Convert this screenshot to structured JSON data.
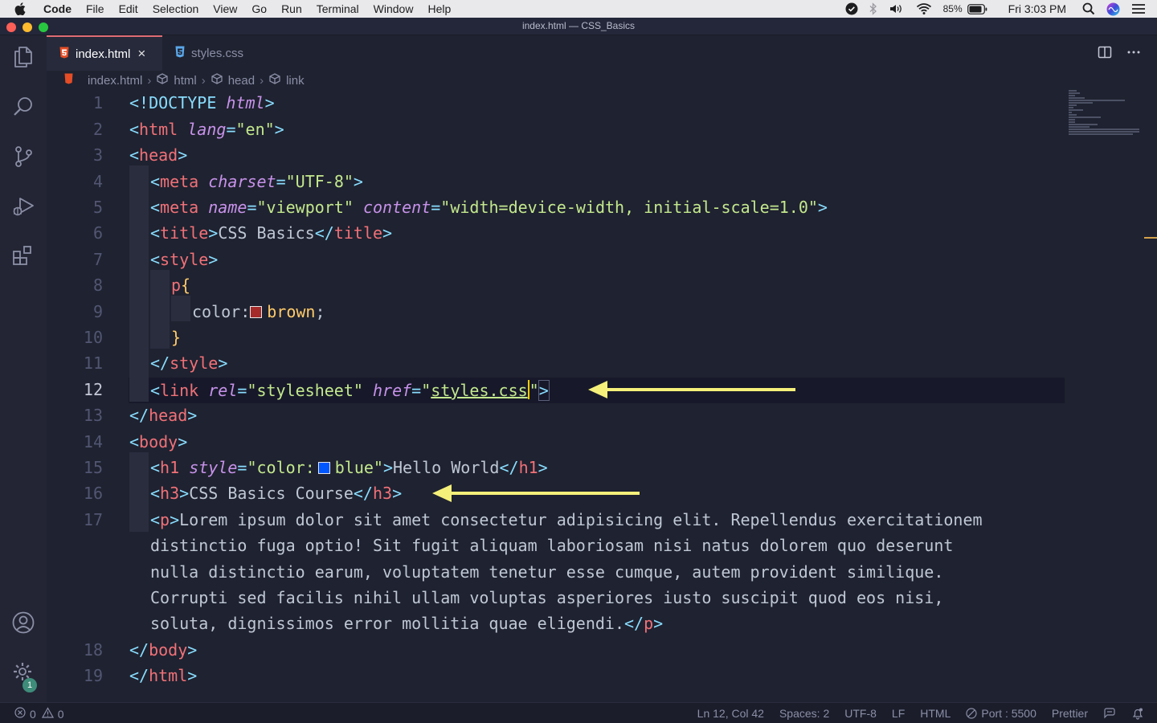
{
  "menubar": {
    "app": "Code",
    "items": [
      "File",
      "Edit",
      "Selection",
      "View",
      "Go",
      "Run",
      "Terminal",
      "Window",
      "Help"
    ],
    "battery": "85%",
    "clock": "Fri 3:03 PM"
  },
  "window": {
    "title": "index.html — CSS_Basics"
  },
  "tabs": [
    {
      "label": "index.html",
      "active": true
    },
    {
      "label": "styles.css",
      "active": false
    }
  ],
  "breadcrumb": [
    "index.html",
    "html",
    "head",
    "link"
  ],
  "editor": {
    "line_numbers": [
      "1",
      "2",
      "3",
      "4",
      "5",
      "6",
      "7",
      "8",
      "9",
      "10",
      "11",
      "12",
      "13",
      "14",
      "15",
      "16",
      "17",
      "18",
      "19"
    ],
    "tokens": {
      "l1_doctype": "<!DOCTYPE ",
      "l1_html": "html",
      "l1_close": ">",
      "l2_open": "<",
      "l2_tag": "html",
      "l2_attr": "lang",
      "l2_eq": "=",
      "l2_val": "\"en\"",
      "l2_close": ">",
      "l3_open": "<",
      "l3_tag": "head",
      "l3_close": ">",
      "l4_open": "<",
      "l4_tag": "meta",
      "l4_attr": "charset",
      "l4_eq": "=",
      "l4_val": "\"UTF-8\"",
      "l4_close": ">",
      "l5_open": "<",
      "l5_tag": "meta",
      "l5_attr1": "name",
      "l5_eq1": "=",
      "l5_val1": "\"viewport\"",
      "l5_attr2": "content",
      "l5_eq2": "=",
      "l5_val2": "\"width=device-width, initial-scale=1.0\"",
      "l5_close": ">",
      "l6_open": "<",
      "l6_tag": "title",
      "l6_mid": ">",
      "l6_text": "CSS Basics",
      "l6_endopen": "</",
      "l6_endtag": "title",
      "l6_close": ">",
      "l7_open": "<",
      "l7_tag": "style",
      "l7_close": ">",
      "l8_sel": "p",
      "l8_brace": "{",
      "l9_prop": "color:",
      "l9_val": "brown",
      "l9_semi": ";",
      "l10_brace": "}",
      "l11_open": "</",
      "l11_tag": "style",
      "l11_close": ">",
      "l12_open": "<",
      "l12_tag": "link",
      "l12_attr1": "rel",
      "l12_eq1": "=",
      "l12_val1": "\"stylesheet\"",
      "l12_attr2": "href",
      "l12_eq2": "=",
      "l12_q1": "\"",
      "l12_file": "styles.css",
      "l12_q2": "\"",
      "l12_close": ">",
      "l13_open": "</",
      "l13_tag": "head",
      "l13_close": ">",
      "l14_open": "<",
      "l14_tag": "body",
      "l14_close": ">",
      "l15_open": "<",
      "l15_tag": "h1",
      "l15_attr": "style",
      "l15_eq": "=",
      "l15_val1": "\"color:",
      "l15_val2": "blue\"",
      "l15_mid": ">",
      "l15_text": "Hello World",
      "l15_endopen": "</",
      "l15_endtag": "h1",
      "l15_close": ">",
      "l16_open": "<",
      "l16_tag": "h3",
      "l16_mid": ">",
      "l16_text": "CSS Basics Course",
      "l16_endopen": "</",
      "l16_endtag": "h3",
      "l16_close": ">",
      "l17_open": "<",
      "l17_tag": "p",
      "l17_mid": ">",
      "l17_text1": "Lorem ipsum dolor sit amet consectetur adipisicing elit. Repellendus exercitationem",
      "l17_text2": "distinctio fuga optio! Sit fugit aliquam laboriosam nisi natus dolorem quo deserunt",
      "l17_text3": "nulla distinctio earum, voluptatem tenetur esse cumque, autem provident similique.",
      "l17_text4": "Corrupti sed facilis nihil ullam voluptas asperiores iusto suscipit quod eos nisi,",
      "l17_text5": "soluta, dignissimos error mollitia quae eligendi.",
      "l17_endopen": "</",
      "l17_endtag": "p",
      "l17_close": ">",
      "l18_open": "</",
      "l18_tag": "body",
      "l18_close": ">",
      "l19_open": "</",
      "l19_tag": "html",
      "l19_close": ">"
    }
  },
  "statusbar": {
    "errors": "0",
    "warnings": "0",
    "position": "Ln 12, Col 42",
    "spaces": "Spaces: 2",
    "encoding": "UTF-8",
    "eol": "LF",
    "language": "HTML",
    "port": "Port : 5500",
    "formatter": "Prettier"
  },
  "activity": {
    "settings_badge": "1"
  },
  "colors": {
    "accent_arrow": "#f5f07a",
    "cursor": "#ffcc00",
    "swatch_brown": "#a52a2a",
    "swatch_blue": "#0000ff"
  },
  "icons": [
    "apple-icon",
    "files-icon",
    "search-icon",
    "source-control-icon",
    "run-debug-icon",
    "extensions-icon",
    "account-icon",
    "manage-gear-icon",
    "html-file-icon",
    "css-file-icon",
    "split-editor-icon",
    "more-actions-icon"
  ]
}
